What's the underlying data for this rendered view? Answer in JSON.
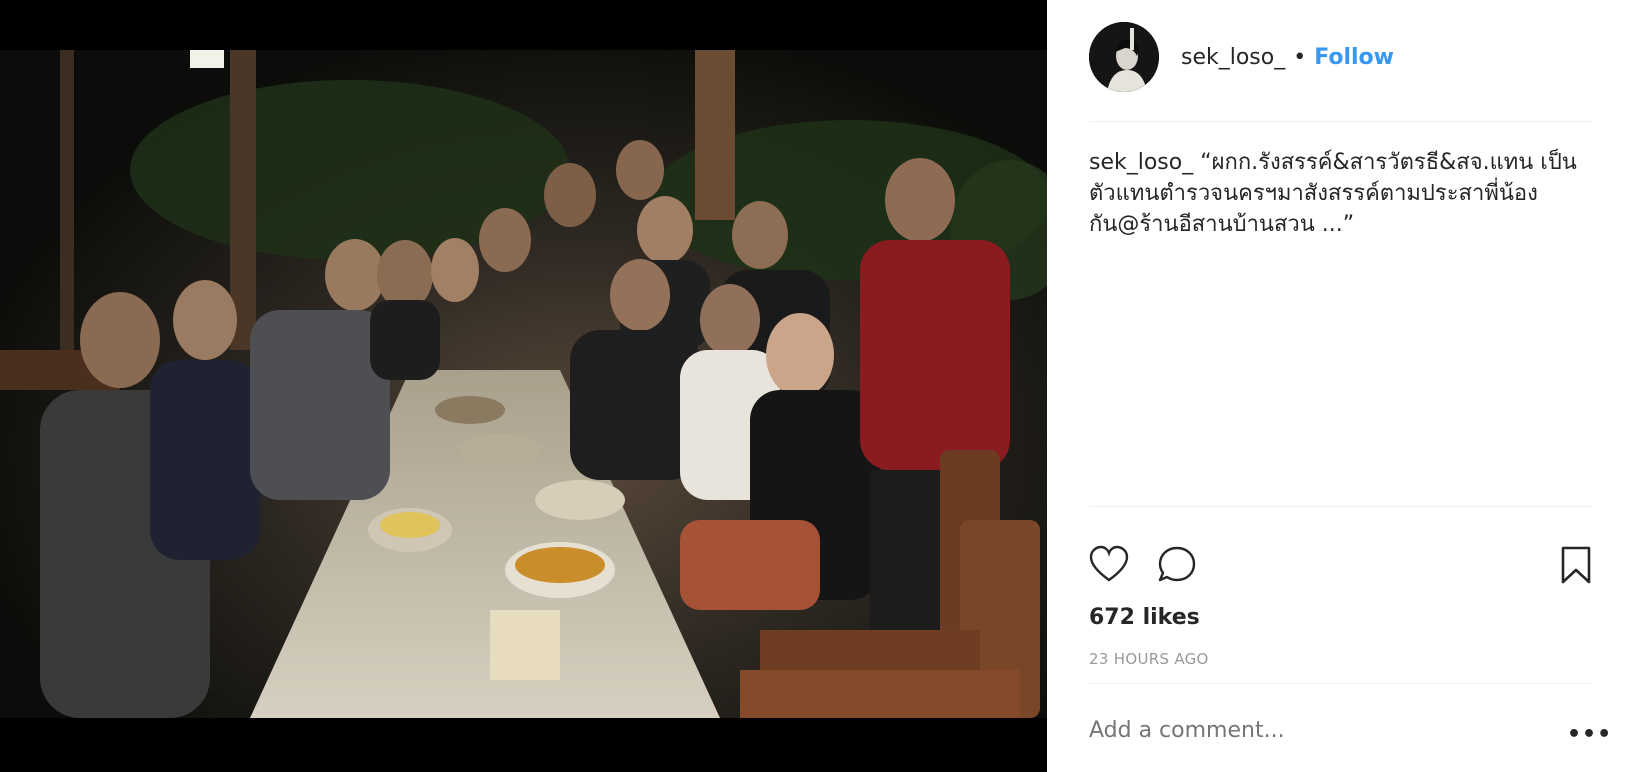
{
  "post": {
    "username": "sek_loso_",
    "separator": "•",
    "follow_label": "Follow",
    "caption_user": "sek_loso_",
    "caption_text": " “ผกก.รังสรรค์&สารวัตรธี&สจ.แทน เป็นตัวแทนตำรวจนครฯมาสังสรรค์ตามประสาพี่น้องกัน@ร้านอีสานบ้านสวน ...”",
    "likes": "672 likes",
    "time": "23 HOURS AGO",
    "comment_placeholder": "Add a comment...",
    "more_label": "•••"
  },
  "icons": {
    "like": "heart-icon",
    "comment": "speech-bubble-icon",
    "save": "bookmark-icon"
  },
  "colors": {
    "follow": "#3897f0",
    "text": "#262626",
    "muted": "#999999"
  }
}
